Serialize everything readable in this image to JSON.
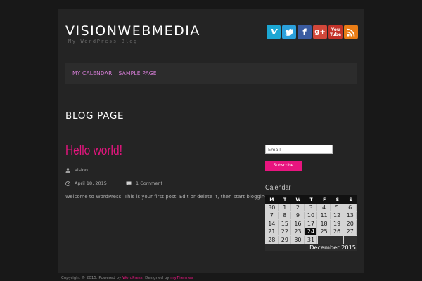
{
  "site": {
    "title": "VISIONWEBMEDIA",
    "tagline": "My WordPress Blog"
  },
  "social": [
    {
      "name": "vimeo",
      "color": "#1ca7d3",
      "glyph": "v"
    },
    {
      "name": "twitter",
      "color": "#2ba0db",
      "glyph": "twitter-bird"
    },
    {
      "name": "facebook",
      "color": "#3a5ba0",
      "glyph": "f"
    },
    {
      "name": "google-plus",
      "color": "#d1473a",
      "glyph": "g+"
    },
    {
      "name": "youtube",
      "color": "#c3332a",
      "glyph": "You Tube"
    },
    {
      "name": "rss",
      "color": "#ea7d16",
      "glyph": "rss"
    }
  ],
  "nav": {
    "items": [
      "MY CALENDAR",
      "SAMPLE PAGE"
    ]
  },
  "main": {
    "page_title": "BLOG PAGE",
    "post": {
      "title": "Hello world!",
      "author": "vision",
      "date": "April 18, 2015",
      "comments": "1 Comment",
      "excerpt": "Welcome to WordPress. This is your first post. Edit or delete it, then start blogging!"
    }
  },
  "sidebar": {
    "email_placeholder": "Email",
    "subscribe_label": "Subscribe",
    "calendar_heading": "Calendar",
    "calendar": {
      "weekdays": [
        "M",
        "T",
        "W",
        "T",
        "F",
        "S",
        "S"
      ],
      "rows": [
        [
          "30",
          "1",
          "2",
          "3",
          "4",
          "5",
          "6"
        ],
        [
          "7",
          "8",
          "9",
          "10",
          "11",
          "12",
          "13"
        ],
        [
          "14",
          "15",
          "16",
          "17",
          "18",
          "19",
          "20"
        ],
        [
          "21",
          "22",
          "23",
          "24",
          "25",
          "26",
          "27"
        ],
        [
          "28",
          "29",
          "30",
          "31",
          "",
          "",
          ""
        ]
      ],
      "today": "24",
      "month_label": "December 2015"
    }
  },
  "footer": {
    "copyright": "Copyright © 2015. Powered by",
    "wordpress": "WordPress",
    "designed_by": ". Designed by",
    "designer": "myThem.es"
  }
}
